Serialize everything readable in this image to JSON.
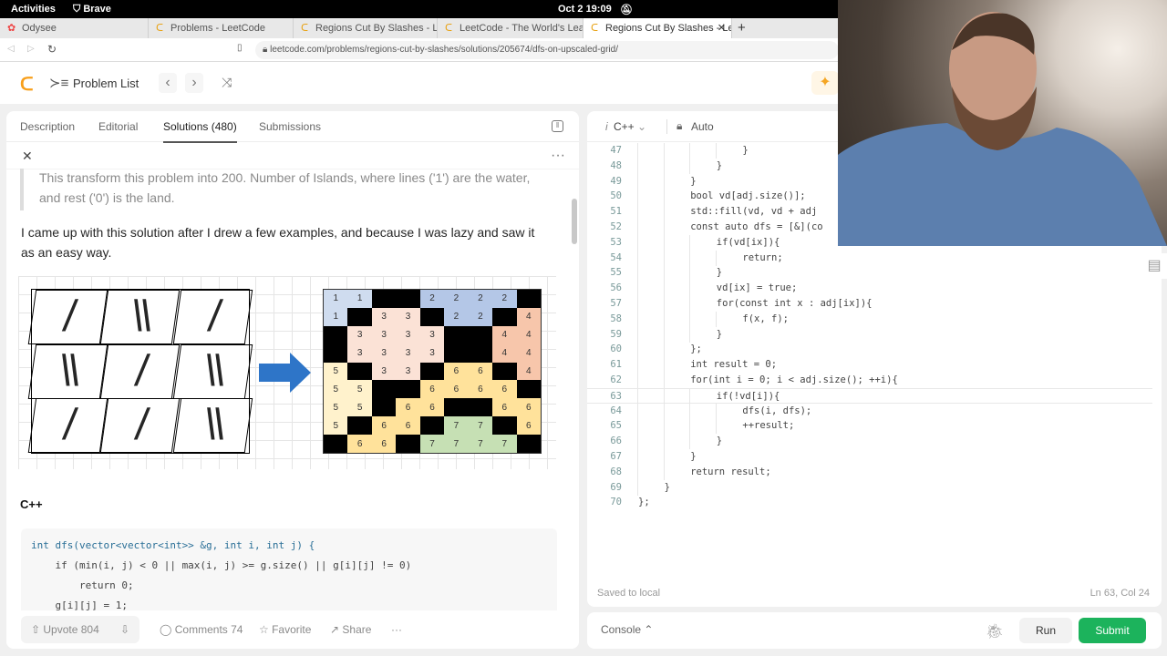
{
  "system": {
    "activities": "Activities",
    "browser": "Brave",
    "datetime": "Oct 2  19:09"
  },
  "browser_tabs": [
    {
      "label": "Odysee"
    },
    {
      "label": "Problems - LeetCode"
    },
    {
      "label": "Regions Cut By Slashes - Leet"
    },
    {
      "label": "LeetCode - The World's Lead"
    },
    {
      "label": "Regions Cut By Slashes - Le"
    }
  ],
  "url": "leetcode.com/problems/regions-cut-by-slashes/solutions/205674/dfs-on-upscaled-grid/",
  "header": {
    "problem_list": "Problem List"
  },
  "left_tabs": [
    {
      "label": "Description"
    },
    {
      "label": "Editorial"
    },
    {
      "label": "Solutions (480)"
    },
    {
      "label": "Submissions"
    }
  ],
  "solution": {
    "quote": "This transform this problem into 200. Number of Islands, where lines ('1') are the water, and rest ('0') is the land.",
    "paragraph": "I came up with this solution after I drew a few examples, and because I was lazy and saw it as an easy way.",
    "figure": {
      "slash_grid": [
        "/",
        "\\\\",
        "/",
        "\\\\",
        "/",
        "\\\\",
        "/",
        "/",
        "\\\\"
      ],
      "upscaled_grid": [
        [
          "1",
          "1",
          "B",
          "B",
          "2",
          "2",
          "2",
          "2",
          "B"
        ],
        [
          "1",
          "B",
          "3",
          "3",
          "B",
          "2",
          "2",
          "B",
          "4"
        ],
        [
          "B",
          "3",
          "3",
          "3",
          "3",
          "B",
          "B",
          "4",
          "4"
        ],
        [
          "B",
          "3",
          "3",
          "3",
          "3",
          "B",
          "B",
          "4",
          "4"
        ],
        [
          "5",
          "B",
          "3",
          "3",
          "B",
          "6",
          "6",
          "B",
          "4"
        ],
        [
          "5",
          "5",
          "B",
          "B",
          "6",
          "6",
          "6",
          "6",
          "B"
        ],
        [
          "5",
          "5",
          "B",
          "6",
          "6",
          "B",
          "B",
          "6",
          "6"
        ],
        [
          "5",
          "B",
          "6",
          "6",
          "B",
          "7",
          "7",
          "B",
          "6"
        ],
        [
          "B",
          "6",
          "6",
          "B",
          "7",
          "7",
          "7",
          "7",
          "B"
        ]
      ],
      "region_colors": {
        "1": "#cfdcef",
        "2": "#b4c7e7",
        "3": "#fbe2d6",
        "4": "#f7c6ab",
        "5": "#fff2cc",
        "6": "#ffe29b",
        "7": "#c6e0b4",
        "B": "#000000"
      },
      "arrow_color": "#2e75c8"
    },
    "lang_heading": "C++",
    "code_lines": [
      "int dfs(vector<vector<int>> &g, int i, int j) {",
      "    if (min(i, j) < 0 || max(i, j) >= g.size() || g[i][j] != 0)",
      "        return 0;",
      "    g[i][j] = 1;"
    ]
  },
  "actions": {
    "upvote": "Upvote 804",
    "comments": "Comments 74",
    "favorite": "Favorite",
    "share": "Share",
    "more": "···"
  },
  "editor": {
    "language": "C++",
    "mode": "Auto",
    "status": "Saved to local",
    "cursor": "Ln 63, Col 24",
    "lines": [
      {
        "n": "47",
        "indent": 4,
        "text": "}"
      },
      {
        "n": "48",
        "indent": 3,
        "text": "}"
      },
      {
        "n": "49",
        "indent": 2,
        "text": "}"
      },
      {
        "n": "50",
        "indent": 2,
        "text": "bool vd[adj.size()];"
      },
      {
        "n": "51",
        "indent": 2,
        "text": "std::fill(vd, vd + adj"
      },
      {
        "n": "52",
        "indent": 2,
        "text": "const auto dfs = [&](co"
      },
      {
        "n": "53",
        "indent": 3,
        "text": "if(vd[ix]){"
      },
      {
        "n": "54",
        "indent": 4,
        "text": "return;"
      },
      {
        "n": "55",
        "indent": 3,
        "text": "}"
      },
      {
        "n": "56",
        "indent": 3,
        "text": "vd[ix] = true;"
      },
      {
        "n": "57",
        "indent": 3,
        "text": "for(const int x : adj[ix]){"
      },
      {
        "n": "58",
        "indent": 4,
        "text": "f(x, f);"
      },
      {
        "n": "59",
        "indent": 3,
        "text": "}"
      },
      {
        "n": "60",
        "indent": 2,
        "text": "};"
      },
      {
        "n": "61",
        "indent": 2,
        "text": "int result = 0;"
      },
      {
        "n": "62",
        "indent": 2,
        "text": "for(int i = 0; i < adj.size(); ++i){"
      },
      {
        "n": "63",
        "indent": 3,
        "text": "if(!vd[i]){"
      },
      {
        "n": "64",
        "indent": 4,
        "text": "dfs(i, dfs);"
      },
      {
        "n": "65",
        "indent": 4,
        "text": "++result;"
      },
      {
        "n": "66",
        "indent": 3,
        "text": "}"
      },
      {
        "n": "67",
        "indent": 2,
        "text": "}"
      },
      {
        "n": "68",
        "indent": 2,
        "text": "return result;"
      },
      {
        "n": "69",
        "indent": 1,
        "text": "}"
      },
      {
        "n": "70",
        "indent": 0,
        "text": "};"
      }
    ],
    "current_line": "63"
  },
  "console": {
    "label": "Console",
    "run": "Run",
    "submit": "Submit",
    "submit_color": "#1cb35c"
  }
}
